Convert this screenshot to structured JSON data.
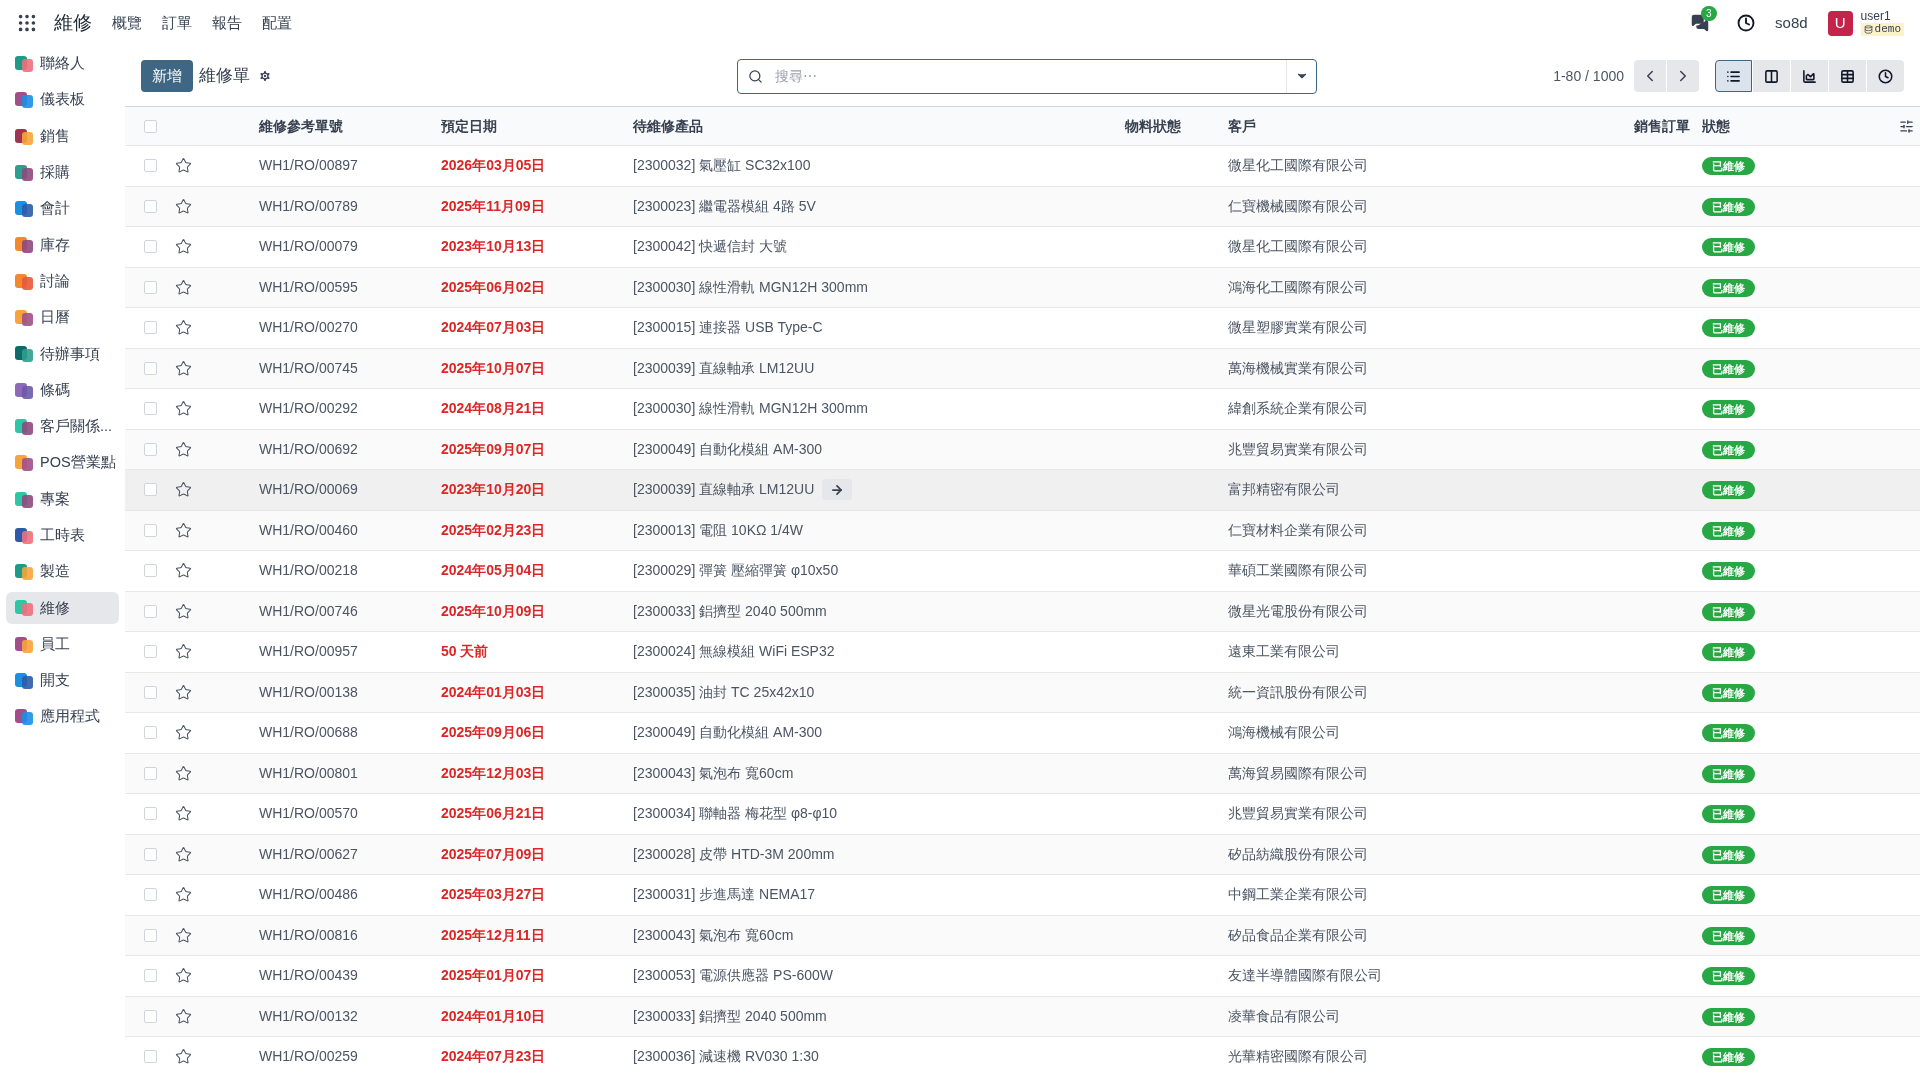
{
  "top_bar": {
    "app_title": "維修",
    "menus": [
      "概覽",
      "訂單",
      "報告",
      "配置"
    ],
    "message_count": "3",
    "company": "so8d",
    "avatar_letter": "U",
    "user": "user1",
    "database": "demo"
  },
  "sidebar": {
    "items": [
      {
        "label": "聯絡人",
        "selected": false
      },
      {
        "label": "儀表板",
        "selected": false
      },
      {
        "label": "銷售",
        "selected": false
      },
      {
        "label": "採購",
        "selected": false
      },
      {
        "label": "會計",
        "selected": false
      },
      {
        "label": "庫存",
        "selected": false
      },
      {
        "label": "討論",
        "selected": false
      },
      {
        "label": "日曆",
        "selected": false
      },
      {
        "label": "待辦事項",
        "selected": false
      },
      {
        "label": "條碼",
        "selected": false
      },
      {
        "label": "客戶關係...",
        "selected": false
      },
      {
        "label": "POS營業點",
        "selected": false
      },
      {
        "label": "專案",
        "selected": false
      },
      {
        "label": "工時表",
        "selected": false
      },
      {
        "label": "製造",
        "selected": false
      },
      {
        "label": "維修",
        "selected": true
      },
      {
        "label": "員工",
        "selected": false
      },
      {
        "label": "開支",
        "selected": false
      },
      {
        "label": "應用程式",
        "selected": false
      }
    ]
  },
  "control_panel": {
    "new_button": "新增",
    "breadcrumb": "維修單",
    "search": {
      "placeholder": "搜尋⋯"
    },
    "pager": "1-80 / 1000",
    "views": [
      {
        "kind": "list",
        "selected": true
      },
      {
        "kind": "kanban",
        "selected": false
      },
      {
        "kind": "graph",
        "selected": false
      },
      {
        "kind": "pivot",
        "selected": false
      },
      {
        "kind": "activity",
        "selected": false
      }
    ]
  },
  "table": {
    "select_all_checked": false,
    "columns": [
      "維修參考單號",
      "預定日期",
      "待維修產品",
      "物料狀態",
      "客戶",
      "銷售訂單",
      "狀態"
    ],
    "rows": [
      {
        "checked": false,
        "ref": "WH1/RO/00897",
        "date": "2026年03月05日",
        "product": "[2300032] 氣壓缸 SC32x100",
        "customer": "微星化工國際有限公司",
        "status": "已維修",
        "highlighted": false
      },
      {
        "checked": false,
        "ref": "WH1/RO/00789",
        "date": "2025年11月09日",
        "product": "[2300023] 繼電器模組 4路 5V",
        "customer": "仁寶機械國際有限公司",
        "status": "已維修",
        "highlighted": false
      },
      {
        "checked": false,
        "ref": "WH1/RO/00079",
        "date": "2023年10月13日",
        "product": "[2300042] 快遞信封 大號",
        "customer": "微星化工國際有限公司",
        "status": "已維修",
        "highlighted": false
      },
      {
        "checked": false,
        "ref": "WH1/RO/00595",
        "date": "2025年06月02日",
        "product": "[2300030] 線性滑軌 MGN12H 300mm",
        "customer": "鴻海化工國際有限公司",
        "status": "已維修",
        "highlighted": false
      },
      {
        "checked": false,
        "ref": "WH1/RO/00270",
        "date": "2024年07月03日",
        "product": "[2300015] 連接器 USB Type-C",
        "customer": "微星塑膠實業有限公司",
        "status": "已維修",
        "highlighted": false
      },
      {
        "checked": false,
        "ref": "WH1/RO/00745",
        "date": "2025年10月07日",
        "product": "[2300039] 直線軸承 LM12UU",
        "customer": "萬海機械實業有限公司",
        "status": "已維修",
        "highlighted": false
      },
      {
        "checked": false,
        "ref": "WH1/RO/00292",
        "date": "2024年08月21日",
        "product": "[2300030] 線性滑軌 MGN12H 300mm",
        "customer": "緯創系統企業有限公司",
        "status": "已維修",
        "highlighted": false
      },
      {
        "checked": false,
        "ref": "WH1/RO/00692",
        "date": "2025年09月07日",
        "product": "[2300049] 自動化模組 AM-300",
        "customer": "兆豐貿易實業有限公司",
        "status": "已維修",
        "highlighted": false
      },
      {
        "checked": false,
        "ref": "WH1/RO/00069",
        "date": "2023年10月20日",
        "product": "[2300039] 直線軸承 LM12UU",
        "customer": "富邦精密有限公司",
        "status": "已維修",
        "highlighted": true
      },
      {
        "checked": false,
        "ref": "WH1/RO/00460",
        "date": "2025年02月23日",
        "product": "[2300013] 電阻 10KΩ 1/4W",
        "customer": "仁寶材料企業有限公司",
        "status": "已維修",
        "highlighted": false
      },
      {
        "checked": false,
        "ref": "WH1/RO/00218",
        "date": "2024年05月04日",
        "product": "[2300029] 彈簧 壓縮彈簧 φ10x50",
        "customer": "華碩工業國際有限公司",
        "status": "已維修",
        "highlighted": false
      },
      {
        "checked": false,
        "ref": "WH1/RO/00746",
        "date": "2025年10月09日",
        "product": "[2300033] 鋁擠型 2040 500mm",
        "customer": "微星光電股份有限公司",
        "status": "已維修",
        "highlighted": false
      },
      {
        "checked": false,
        "ref": "WH1/RO/00957",
        "date": "50 天前",
        "product": "[2300024] 無線模組 WiFi ESP32",
        "customer": "遠東工業有限公司",
        "status": "已維修",
        "highlighted": false
      },
      {
        "checked": false,
        "ref": "WH1/RO/00138",
        "date": "2024年01月03日",
        "product": "[2300035] 油封 TC 25x42x10",
        "customer": "統一資訊股份有限公司",
        "status": "已維修",
        "highlighted": false
      },
      {
        "checked": false,
        "ref": "WH1/RO/00688",
        "date": "2025年09月06日",
        "product": "[2300049] 自動化模組 AM-300",
        "customer": "鴻海機械有限公司",
        "status": "已維修",
        "highlighted": false
      },
      {
        "checked": false,
        "ref": "WH1/RO/00801",
        "date": "2025年12月03日",
        "product": "[2300043] 氣泡布 寬60cm",
        "customer": "萬海貿易國際有限公司",
        "status": "已維修",
        "highlighted": false
      },
      {
        "checked": false,
        "ref": "WH1/RO/00570",
        "date": "2025年06月21日",
        "product": "[2300034] 聯軸器 梅花型 φ8-φ10",
        "customer": "兆豐貿易實業有限公司",
        "status": "已維修",
        "highlighted": false
      },
      {
        "checked": false,
        "ref": "WH1/RO/00627",
        "date": "2025年07月09日",
        "product": "[2300028] 皮帶 HTD-3M 200mm",
        "customer": "矽品紡織股份有限公司",
        "status": "已維修",
        "highlighted": false
      },
      {
        "checked": false,
        "ref": "WH1/RO/00486",
        "date": "2025年03月27日",
        "product": "[2300031] 步進馬達 NEMA17",
        "customer": "中鋼工業企業有限公司",
        "status": "已維修",
        "highlighted": false
      },
      {
        "checked": false,
        "ref": "WH1/RO/00816",
        "date": "2025年12月11日",
        "product": "[2300043] 氣泡布 寬60cm",
        "customer": "矽品食品企業有限公司",
        "status": "已維修",
        "highlighted": false
      },
      {
        "checked": false,
        "ref": "WH1/RO/00439",
        "date": "2025年01月07日",
        "product": "[2300053] 電源供應器 PS-600W",
        "customer": "友達半導體國際有限公司",
        "status": "已維修",
        "highlighted": false
      },
      {
        "checked": false,
        "ref": "WH1/RO/00132",
        "date": "2024年01月10日",
        "product": "[2300033] 鋁擠型 2040 500mm",
        "customer": "凌華食品有限公司",
        "status": "已維修",
        "highlighted": false
      },
      {
        "checked": false,
        "ref": "WH1/RO/00259",
        "date": "2024年07月23日",
        "product": "[2300036] 減速機 RV030 1:30",
        "customer": "光華精密國際有限公司",
        "status": "已維修",
        "highlighted": false
      }
    ]
  }
}
